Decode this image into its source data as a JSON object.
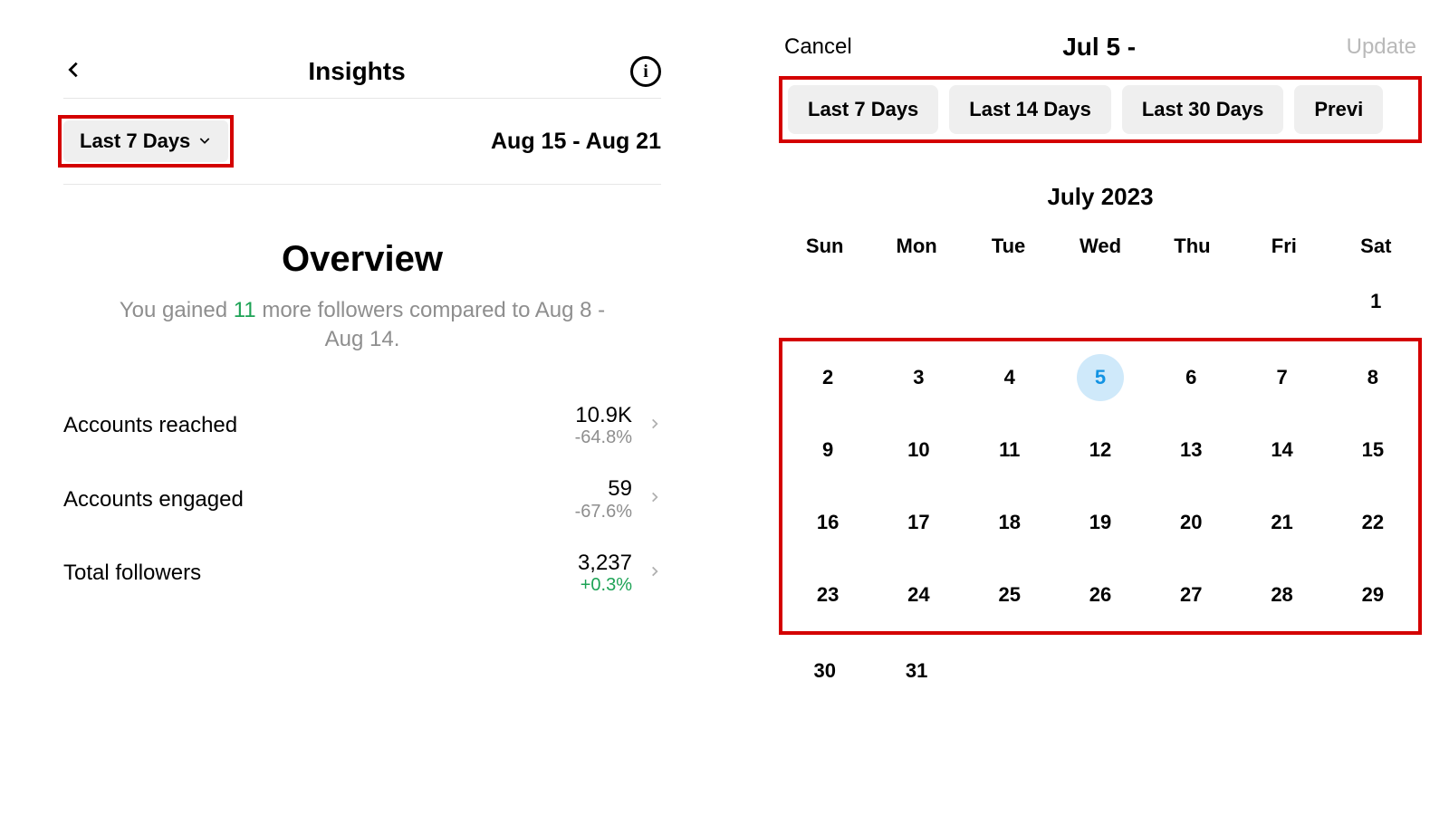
{
  "insights": {
    "title": "Insights",
    "range_label": "Last 7 Days",
    "date_range": "Aug 15 - Aug 21",
    "overview_title": "Overview",
    "overview_line1_pre": "You gained ",
    "overview_line1_count": "11",
    "overview_line1_post": " more followers compared to Aug 8 - Aug 14.",
    "metrics": [
      {
        "label": "Accounts reached",
        "value": "10.9K",
        "delta": "-64.8%",
        "positive": false
      },
      {
        "label": "Accounts engaged",
        "value": "59",
        "delta": "-67.6%",
        "positive": false
      },
      {
        "label": "Total followers",
        "value": "3,237",
        "delta": "+0.3%",
        "positive": true
      }
    ]
  },
  "datepicker": {
    "cancel": "Cancel",
    "title": "Jul 5 -",
    "update": "Update",
    "pills": [
      "Last 7 Days",
      "Last 14 Days",
      "Last 30 Days",
      "Previ"
    ],
    "month_title": "July 2023",
    "dow": [
      "Sun",
      "Mon",
      "Tue",
      "Wed",
      "Thu",
      "Fri",
      "Sat"
    ],
    "selected_day": 5,
    "weeks": [
      [
        "",
        "",
        "",
        "",
        "",
        "",
        "1"
      ],
      [
        "2",
        "3",
        "4",
        "5",
        "6",
        "7",
        "8"
      ],
      [
        "9",
        "10",
        "11",
        "12",
        "13",
        "14",
        "15"
      ],
      [
        "16",
        "17",
        "18",
        "19",
        "20",
        "21",
        "22"
      ],
      [
        "23",
        "24",
        "25",
        "26",
        "27",
        "28",
        "29"
      ],
      [
        "30",
        "31",
        "",
        "",
        "",
        "",
        ""
      ]
    ],
    "highlight_weeks": [
      1,
      2,
      3,
      4
    ]
  }
}
